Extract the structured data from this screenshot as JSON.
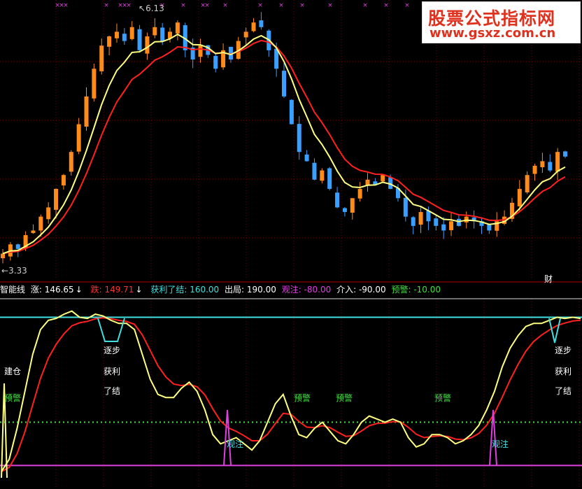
{
  "watermark": {
    "title": "股票公式指标网",
    "url": "www.gsxz.com.cn"
  },
  "top_labels": {
    "high": "6.13",
    "low": "3.33",
    "cai": "财"
  },
  "indicator_header": {
    "name": "智能线",
    "items": [
      {
        "label": "涨: 146.65",
        "color": "#ffffff",
        "arrow": "↓"
      },
      {
        "label": "跌: 149.71",
        "color": "#ff3030",
        "arrow": "↓"
      },
      {
        "label": "获利了结: 160.00",
        "color": "#40e0e0",
        "arrow": ""
      },
      {
        "label": "出局: 190.00",
        "color": "#ffffff",
        "arrow": ""
      },
      {
        "label": "观注: -80.00",
        "color": "#e040e0",
        "arrow": ""
      },
      {
        "label": "介入: -90.00",
        "color": "#ffffff",
        "arrow": ""
      },
      {
        "label": "预警: -10.00",
        "color": "#40e040",
        "arrow": ""
      }
    ]
  },
  "annotations": {
    "jiancang": "建仓",
    "yujing": "预警",
    "zhubu": "逐步",
    "huoli": "获利",
    "lejie": "了结",
    "guanzhu": "观注"
  },
  "colors": {
    "up_candle": "#ff8c1a",
    "down_candle": "#3aa0ff",
    "ma_yellow": "#ffff80",
    "ma_red": "#ff2020",
    "cyan": "#40e0e0",
    "magenta": "#e040e0",
    "green": "#40e040"
  },
  "chart_data": [
    {
      "type": "candlestick",
      "title": "",
      "ylim": [
        3.33,
        6.13
      ],
      "price_markers": {
        "high": 6.13,
        "low": 3.33
      },
      "close_profile": [
        3.5,
        3.6,
        3.55,
        3.7,
        3.75,
        3.9,
        4.0,
        4.2,
        4.35,
        4.6,
        4.9,
        5.2,
        5.5,
        5.75,
        5.85,
        5.9,
        5.8,
        5.95,
        5.7,
        5.85,
        5.95,
        5.8,
        5.9,
        6.0,
        5.7,
        5.6,
        5.75,
        5.65,
        5.5,
        5.7,
        5.6,
        5.8,
        5.9,
        6.0,
        5.95,
        5.7,
        5.5,
        5.2,
        4.9,
        4.6,
        4.5,
        4.3,
        4.4,
        4.2,
        4.0,
        3.95,
        4.1,
        4.2,
        4.3,
        4.25,
        4.35,
        4.2,
        4.1,
        3.9,
        3.8,
        3.95,
        3.85,
        3.8,
        3.75,
        3.85,
        3.8,
        3.9,
        3.85,
        3.8,
        3.75,
        3.85,
        3.9,
        4.05,
        4.2,
        4.35,
        4.45,
        4.5,
        4.4,
        4.6,
        4.55
      ]
    },
    {
      "type": "line",
      "title": "智能线",
      "ylim": [
        -100,
        190
      ],
      "levels": {
        "获利了结": 160,
        "出局": 190,
        "观注": -80,
        "介入": -90,
        "预警": -10
      },
      "series": [
        {
          "name": "涨",
          "last": 146.65
        },
        {
          "name": "跌",
          "last": 149.71
        }
      ]
    }
  ]
}
